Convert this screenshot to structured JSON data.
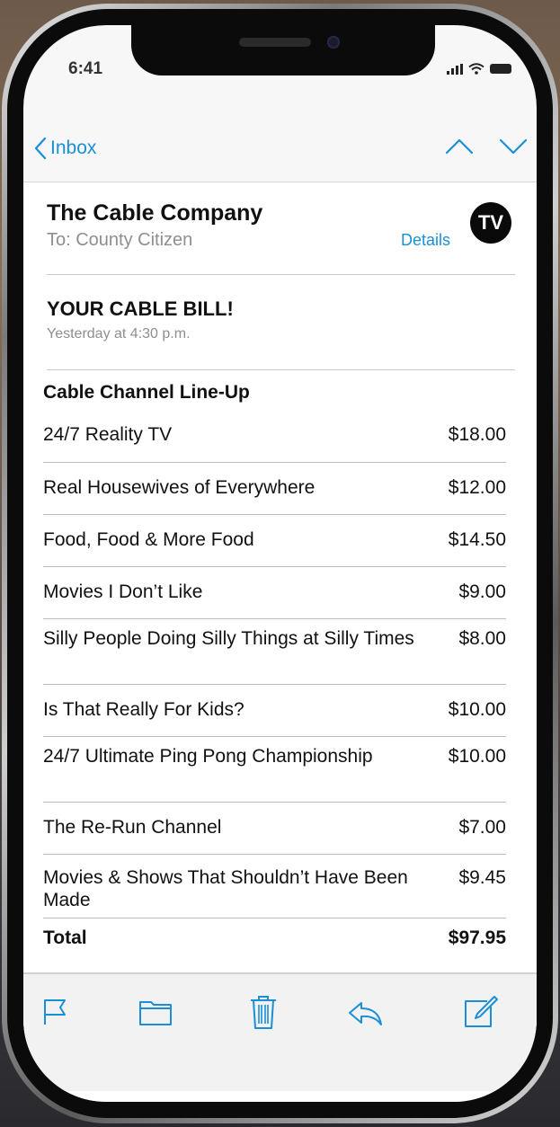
{
  "status_bar": {
    "time": "6:41"
  },
  "nav": {
    "back_label": "Inbox"
  },
  "email": {
    "sender": "The Cable Company",
    "to": "To: County Citizen",
    "details_label": "Details",
    "avatar_text": "TV",
    "subject": "YOUR CABLE BILL!",
    "date": "Yesterday at 4:30 p.m."
  },
  "bill": {
    "heading": "Cable Channel Line-Up",
    "items": [
      {
        "name": "24/7 Reality TV",
        "price": "$18.00"
      },
      {
        "name": "Real Housewives of Everywhere",
        "price": "$12.00"
      },
      {
        "name": "Food, Food & More Food",
        "price": "$14.50"
      },
      {
        "name": "Movies I Don’t Like",
        "price": "$9.00"
      },
      {
        "name": "Silly People Doing Silly Things at Silly Times",
        "price": "$8.00"
      },
      {
        "name": "Is That Really For Kids?",
        "price": "$10.00"
      },
      {
        "name": "24/7 Ultimate Ping Pong Championship",
        "price": "$10.00"
      },
      {
        "name": "The Re-Run Channel",
        "price": "$7.00"
      },
      {
        "name": "Movies & Shows That Shouldn’t Have Been Made",
        "price": "$9.45"
      }
    ],
    "total_label": "Total",
    "total_value": "$97.95"
  },
  "colors": {
    "accent": "#1a8fd6"
  },
  "toolbar_icons": [
    "flag-icon",
    "folder-icon",
    "trash-icon",
    "reply-icon",
    "compose-icon"
  ]
}
